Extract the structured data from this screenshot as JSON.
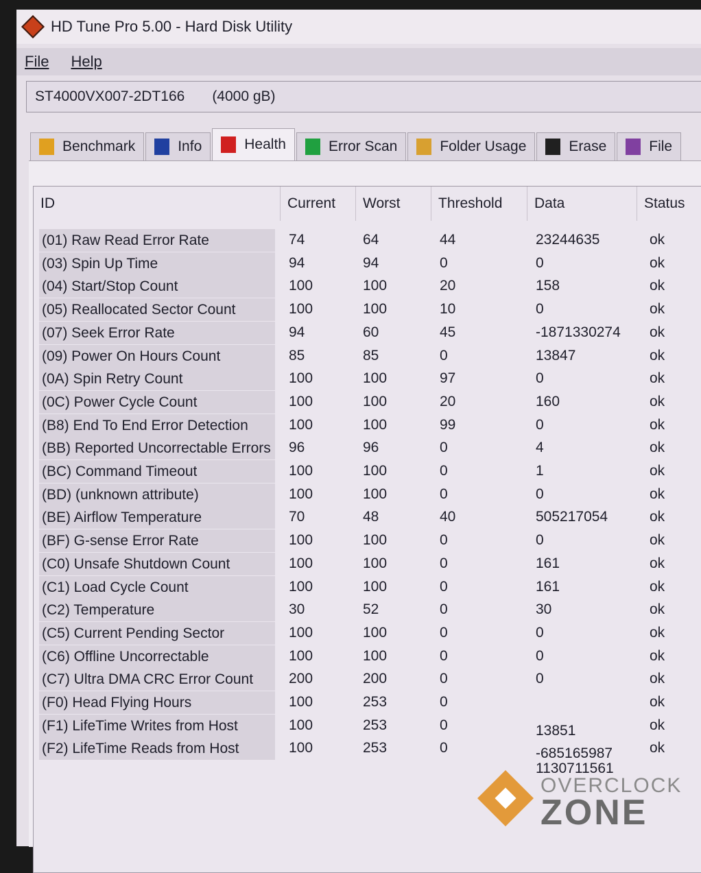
{
  "window": {
    "title": "HD Tune Pro 5.00 - Hard Disk Utility"
  },
  "menu": [
    "File",
    "Help"
  ],
  "drive": {
    "model": "ST4000VX007-2DT166",
    "capacity": "(4000 gB)"
  },
  "tabs": [
    {
      "label": "Benchmark",
      "icon": "lightbulb-icon",
      "color": "#e0a020"
    },
    {
      "label": "Info",
      "icon": "info-person-icon",
      "color": "#2040a0"
    },
    {
      "label": "Health",
      "icon": "red-cross-icon",
      "color": "#d02020",
      "active": true
    },
    {
      "label": "Error Scan",
      "icon": "magnifier-icon",
      "color": "#20a040"
    },
    {
      "label": "Folder Usage",
      "icon": "folder-icon",
      "color": "#d8a030"
    },
    {
      "label": "Erase",
      "icon": "trash-icon",
      "color": "#202020"
    },
    {
      "label": "File",
      "icon": "file-icon",
      "color": "#8040a0"
    }
  ],
  "table": {
    "headers": [
      "ID",
      "Current",
      "Worst",
      "Threshold",
      "Data",
      "Status"
    ],
    "rows": [
      [
        "(01) Raw Read Error Rate",
        "74",
        "64",
        "44",
        "23244635",
        "ok"
      ],
      [
        "(03) Spin Up Time",
        "94",
        "94",
        "0",
        "0",
        "ok"
      ],
      [
        "(04) Start/Stop Count",
        "100",
        "100",
        "20",
        "158",
        "ok"
      ],
      [
        "(05) Reallocated Sector Count",
        "100",
        "100",
        "10",
        "0",
        "ok"
      ],
      [
        "(07) Seek Error Rate",
        "94",
        "60",
        "45",
        "-1871330274",
        "ok"
      ],
      [
        "(09) Power On Hours Count",
        "85",
        "85",
        "0",
        "13847",
        "ok"
      ],
      [
        "(0A) Spin Retry Count",
        "100",
        "100",
        "97",
        "0",
        "ok"
      ],
      [
        "(0C) Power Cycle Count",
        "100",
        "100",
        "20",
        "160",
        "ok"
      ],
      [
        "(B8) End To End Error Detection",
        "100",
        "100",
        "99",
        "0",
        "ok"
      ],
      [
        "(BB) Reported Uncorrectable Errors",
        "96",
        "96",
        "0",
        "4",
        "ok"
      ],
      [
        "(BC) Command Timeout",
        "100",
        "100",
        "0",
        "1",
        "ok"
      ],
      [
        "(BD) (unknown attribute)",
        "100",
        "100",
        "0",
        "0",
        "ok"
      ],
      [
        "(BE) Airflow Temperature",
        "70",
        "48",
        "40",
        "505217054",
        "ok"
      ],
      [
        "(BF) G-sense Error Rate",
        "100",
        "100",
        "0",
        "0",
        "ok"
      ],
      [
        "(C0) Unsafe Shutdown Count",
        "100",
        "100",
        "0",
        "161",
        "ok"
      ],
      [
        "(C1) Load Cycle Count",
        "100",
        "100",
        "0",
        "161",
        "ok"
      ],
      [
        "(C2) Temperature",
        "30",
        "52",
        "0",
        "30",
        "ok"
      ],
      [
        "(C5) Current Pending Sector",
        "100",
        "100",
        "0",
        "0",
        "ok"
      ],
      [
        "(C6) Offline Uncorrectable",
        "100",
        "100",
        "0",
        "0",
        "ok"
      ],
      [
        "(C7) Ultra DMA CRC Error Count",
        "200",
        "200",
        "0",
        "0",
        "ok"
      ],
      [
        "(F0) Head Flying Hours",
        "100",
        "253",
        "0",
        "",
        "ok"
      ],
      [
        "(F1) LifeTime Writes from Host",
        "100",
        "253",
        "0",
        "13851",
        "ok"
      ],
      [
        "(F2) LifeTime Reads from Host",
        "100",
        "253",
        "0",
        "-685165987",
        "ok"
      ]
    ],
    "extra_data": "1130711561"
  },
  "watermark": {
    "line1": "OVERCLOCK",
    "line2": "ZONE"
  }
}
